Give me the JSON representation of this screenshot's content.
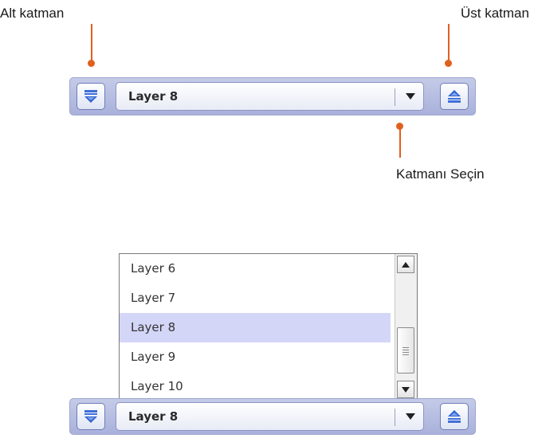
{
  "callouts": {
    "lower_layer": "Alt katman",
    "upper_layer": "Üst katman",
    "select_layer": "Katmanı Seçin"
  },
  "toolbar_top": {
    "selected_layer": "Layer 8",
    "lower_button_icon": "arrow-down-icon",
    "upper_button_icon": "arrow-up-icon"
  },
  "dropdown": {
    "items": [
      {
        "label": "Layer 6"
      },
      {
        "label": "Layer 7"
      },
      {
        "label": "Layer 8"
      },
      {
        "label": "Layer 9"
      },
      {
        "label": "Layer 10"
      }
    ],
    "selected_index": 2
  },
  "toolbar_bottom": {
    "selected_layer": "Layer 8"
  },
  "colors": {
    "accent": "#e0601e",
    "toolbar": "#b6bde2",
    "highlight": "#d4d6f8"
  }
}
